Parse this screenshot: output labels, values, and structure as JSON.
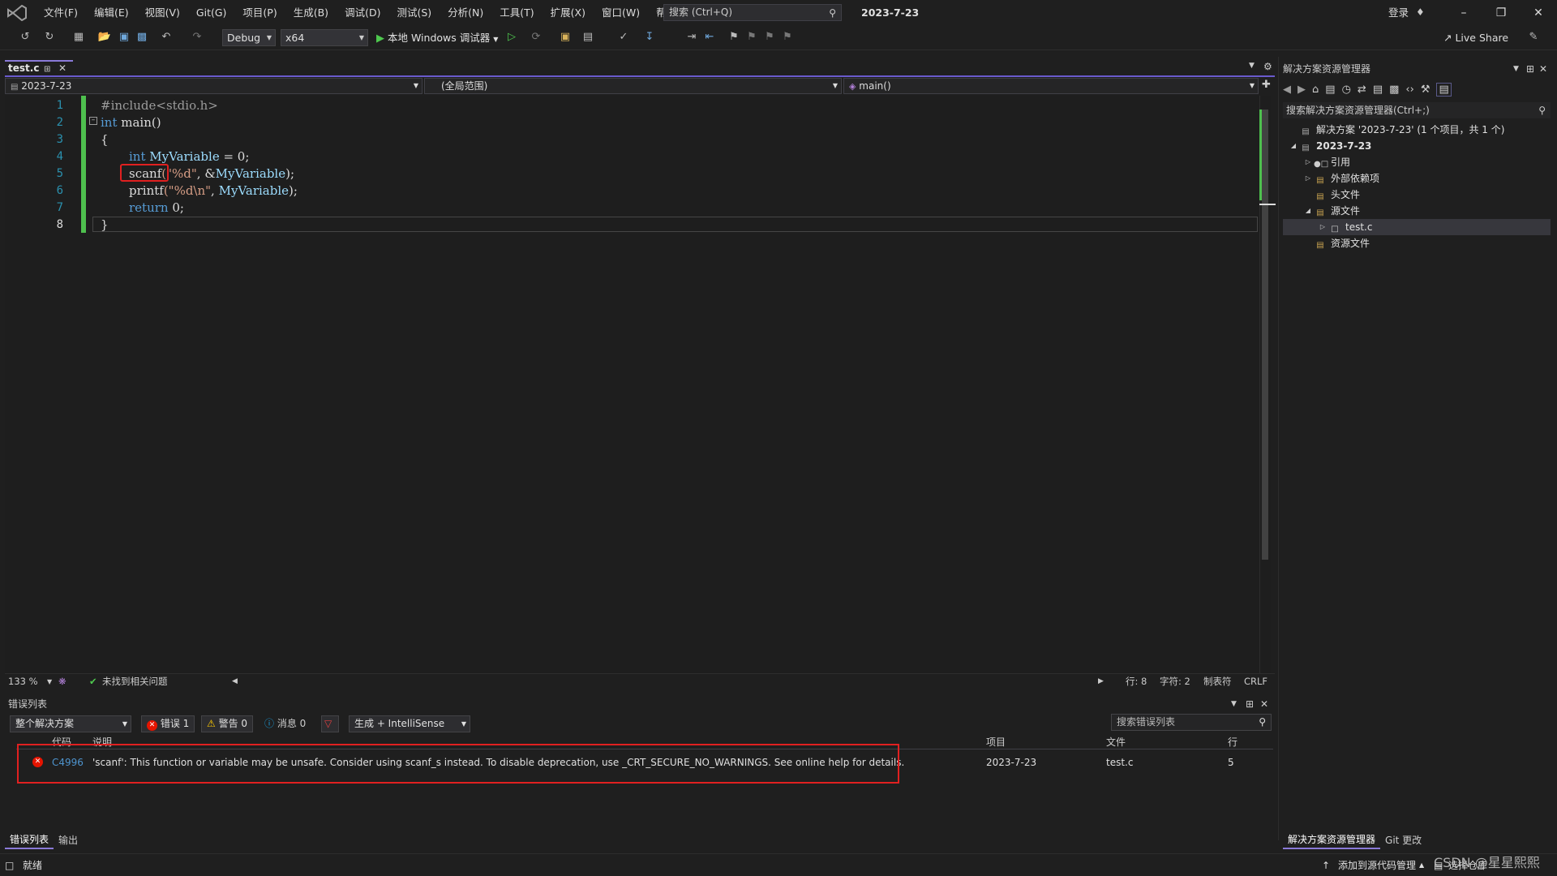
{
  "titlebar": {
    "menu": [
      "文件(F)",
      "编辑(E)",
      "视图(V)",
      "Git(G)",
      "项目(P)",
      "生成(B)",
      "调试(D)",
      "测试(S)",
      "分析(N)",
      "工具(T)",
      "扩展(X)",
      "窗口(W)",
      "帮助(H)"
    ],
    "search_placeholder": "搜索 (Ctrl+Q)",
    "solution_name": "2023-7-23",
    "login": "登录"
  },
  "toolbar": {
    "config": "Debug",
    "platform": "x64",
    "run_label": "本地 Windows 调试器",
    "live_share": "Live Share"
  },
  "editor": {
    "tab_name": "test.c",
    "nav_project": "2023-7-23",
    "nav_scope": "(全局范围)",
    "nav_member": "main()",
    "line_numbers": [
      "1",
      "2",
      "3",
      "4",
      "5",
      "6",
      "7",
      "8"
    ],
    "code": {
      "l1_pre": "#include",
      "l1_hdr": "<stdio.h>",
      "l2_kw": "int",
      "l2_rest": " main()",
      "l3": "{",
      "l4_kw": "int",
      "l4_var": "MyVariable",
      "l4_rest": " = 0;",
      "l5_fn": "scanf",
      "l5_str": "(\"%d\"",
      "l5_rest": ", &",
      "l5_var": "MyVariable",
      "l5_end": ");",
      "l6_fn": "printf",
      "l6_str": "(\"%d\\n\"",
      "l6_rest": ", ",
      "l6_var": "MyVariable",
      "l6_end": ");",
      "l7_kw": "return",
      "l7_rest": " 0;",
      "l8": "}"
    },
    "zoom": "133 %",
    "issues": "未找到相关问题",
    "line": "行: 8",
    "char": "字符: 2",
    "tabs": "制表符",
    "eol": "CRLF"
  },
  "error_list": {
    "title": "错误列表",
    "scope": "整个解决方案",
    "errors": "错误 1",
    "warnings": "警告 0",
    "messages": "消息 0",
    "build_filter": "生成 + IntelliSense",
    "search_placeholder": "搜索错误列表",
    "columns": {
      "code": "代码",
      "desc": "说明",
      "project": "项目",
      "file": "文件",
      "line": "行"
    },
    "rows": [
      {
        "code": "C4996",
        "desc": "'scanf': This function or variable may be unsafe. Consider using scanf_s instead. To disable deprecation, use _CRT_SECURE_NO_WARNINGS. See online help for details.",
        "project": "2023-7-23",
        "file": "test.c",
        "line": "5"
      }
    ],
    "bottom_tabs": [
      "错误列表",
      "输出"
    ]
  },
  "solution_explorer": {
    "title": "解决方案资源管理器",
    "search_placeholder": "搜索解决方案资源管理器(Ctrl+;)",
    "tree": {
      "solution": "解决方案 '2023-7-23' (1 个项目，共 1 个)",
      "project": "2023-7-23",
      "refs": "引用",
      "ext_deps": "外部依赖项",
      "headers": "头文件",
      "sources": "源文件",
      "file": "test.c",
      "resources": "资源文件"
    },
    "bottom_tabs": [
      "解决方案资源管理器",
      "Git 更改"
    ]
  },
  "statusbar": {
    "ready": "就绪",
    "source_control": "添加到源代码管理",
    "repo": "选择仓库"
  },
  "watermark": "CSDN @星星熙熙"
}
